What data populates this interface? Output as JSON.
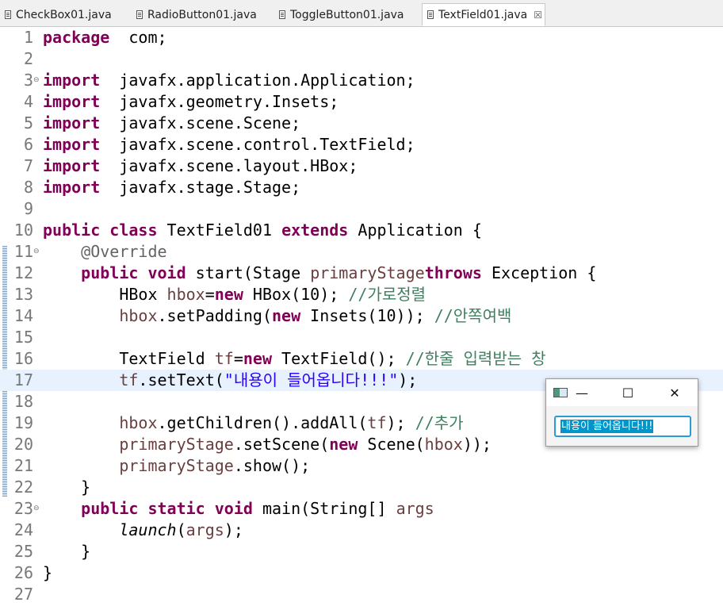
{
  "tabs": [
    {
      "label": "CheckBox01.java",
      "active": false
    },
    {
      "label": "RadioButton01.java",
      "active": false
    },
    {
      "label": "ToggleButton01.java",
      "active": false
    },
    {
      "label": "TextField01.java",
      "active": true
    }
  ],
  "tab_close_glyph": "☒",
  "editor": {
    "current_line": 17,
    "lines": [
      {
        "n": "1",
        "t": [
          [
            "kw",
            "package"
          ],
          [
            "",
            "  com;"
          ]
        ]
      },
      {
        "n": "2",
        "t": []
      },
      {
        "n": "3",
        "fold": true,
        "t": [
          [
            "kw",
            "import"
          ],
          [
            "",
            "  javafx.application.Application;"
          ]
        ]
      },
      {
        "n": "4",
        "t": [
          [
            "kw",
            "import"
          ],
          [
            "",
            "  javafx.geometry.Insets;"
          ]
        ]
      },
      {
        "n": "5",
        "t": [
          [
            "kw",
            "import"
          ],
          [
            "",
            "  javafx.scene.Scene;"
          ]
        ]
      },
      {
        "n": "6",
        "t": [
          [
            "kw",
            "import"
          ],
          [
            "",
            "  javafx.scene.control.TextField;"
          ]
        ]
      },
      {
        "n": "7",
        "t": [
          [
            "kw",
            "import"
          ],
          [
            "",
            "  javafx.scene.layout.HBox;"
          ]
        ]
      },
      {
        "n": "8",
        "t": [
          [
            "kw",
            "import"
          ],
          [
            "",
            "  javafx.stage.Stage;"
          ]
        ]
      },
      {
        "n": "9",
        "t": []
      },
      {
        "n": "10",
        "t": [
          [
            "kw",
            "public"
          ],
          [
            "",
            " "
          ],
          [
            "kw",
            "class"
          ],
          [
            "",
            " TextField01 "
          ],
          [
            "kw",
            "extends"
          ],
          [
            "",
            " Application {"
          ]
        ]
      },
      {
        "n": "11",
        "fold": true,
        "t": [
          [
            "",
            "    "
          ],
          [
            "an",
            "@Override"
          ]
        ]
      },
      {
        "n": "12",
        "t": [
          [
            "",
            "    "
          ],
          [
            "kw",
            "public"
          ],
          [
            "",
            " "
          ],
          [
            "kw",
            "void"
          ],
          [
            "",
            " start(Stage "
          ],
          [
            "vr",
            "primaryStage"
          ],
          [
            ") "
          ],
          [
            "kw",
            "throws"
          ],
          [
            "",
            " Exception {"
          ]
        ]
      },
      {
        "n": "13",
        "t": [
          [
            "",
            "        HBox "
          ],
          [
            "vr",
            "hbox"
          ],
          [
            "",
            "="
          ],
          [
            "kw",
            "new"
          ],
          [
            "",
            " HBox(10); "
          ],
          [
            "cm",
            "//가로정렬"
          ]
        ]
      },
      {
        "n": "14",
        "t": [
          [
            "",
            "        "
          ],
          [
            "vr",
            "hbox"
          ],
          [
            "",
            ".setPadding("
          ],
          [
            "kw",
            "new"
          ],
          [
            "",
            " Insets(10)); "
          ],
          [
            "cm",
            "//안쪽여백"
          ]
        ]
      },
      {
        "n": "15",
        "t": []
      },
      {
        "n": "16",
        "t": [
          [
            "",
            "        TextField "
          ],
          [
            "vr",
            "tf"
          ],
          [
            "",
            "="
          ],
          [
            "kw",
            "new"
          ],
          [
            "",
            " TextField(); "
          ],
          [
            "cm",
            "//한줄 입력받는 창"
          ]
        ]
      },
      {
        "n": "17",
        "t": [
          [
            "",
            "        "
          ],
          [
            "vr",
            "tf"
          ],
          [
            "",
            ".setText("
          ],
          [
            "st",
            "\"내용이 들어옵니다!!!\""
          ],
          [
            "",
            ");"
          ]
        ]
      },
      {
        "n": "18",
        "t": []
      },
      {
        "n": "19",
        "t": [
          [
            "",
            "        "
          ],
          [
            "vr",
            "hbox"
          ],
          [
            "",
            ".getChildren().addAll("
          ],
          [
            "vr",
            "tf"
          ],
          [
            "",
            "); "
          ],
          [
            "cm",
            "//추가"
          ]
        ]
      },
      {
        "n": "20",
        "t": [
          [
            "",
            "        "
          ],
          [
            "vr",
            "primaryStage"
          ],
          [
            "",
            ".setScene("
          ],
          [
            "kw",
            "new"
          ],
          [
            "",
            " Scene("
          ],
          [
            "vr",
            "hbox"
          ],
          [
            "",
            "));"
          ]
        ]
      },
      {
        "n": "21",
        "t": [
          [
            "",
            "        "
          ],
          [
            "vr",
            "primaryStage"
          ],
          [
            "",
            ".show();"
          ]
        ]
      },
      {
        "n": "22",
        "t": [
          [
            "",
            "    }"
          ]
        ]
      },
      {
        "n": "23",
        "fold": true,
        "t": [
          [
            "",
            "    "
          ],
          [
            "kw",
            "public"
          ],
          [
            "",
            " "
          ],
          [
            "kw",
            "static"
          ],
          [
            "",
            " "
          ],
          [
            "kw",
            "void"
          ],
          [
            "",
            " main(String[] "
          ],
          [
            "vr",
            "args"
          ],
          [
            ") {"
          ]
        ]
      },
      {
        "n": "24",
        "t": [
          [
            "",
            "        "
          ],
          [
            "it",
            "launch"
          ],
          [
            "",
            "("
          ],
          [
            "vr",
            "args"
          ],
          [
            "",
            ");"
          ]
        ]
      },
      {
        "n": "25",
        "t": [
          [
            "",
            "    }"
          ]
        ]
      },
      {
        "n": "26",
        "t": [
          [
            "",
            "}"
          ]
        ]
      },
      {
        "n": "27",
        "t": []
      }
    ]
  },
  "fx_window": {
    "minimize_glyph": "—",
    "maximize_glyph": "☐",
    "close_glyph": "✕",
    "textfield_value": "내용이 들어옵니다!!!"
  }
}
